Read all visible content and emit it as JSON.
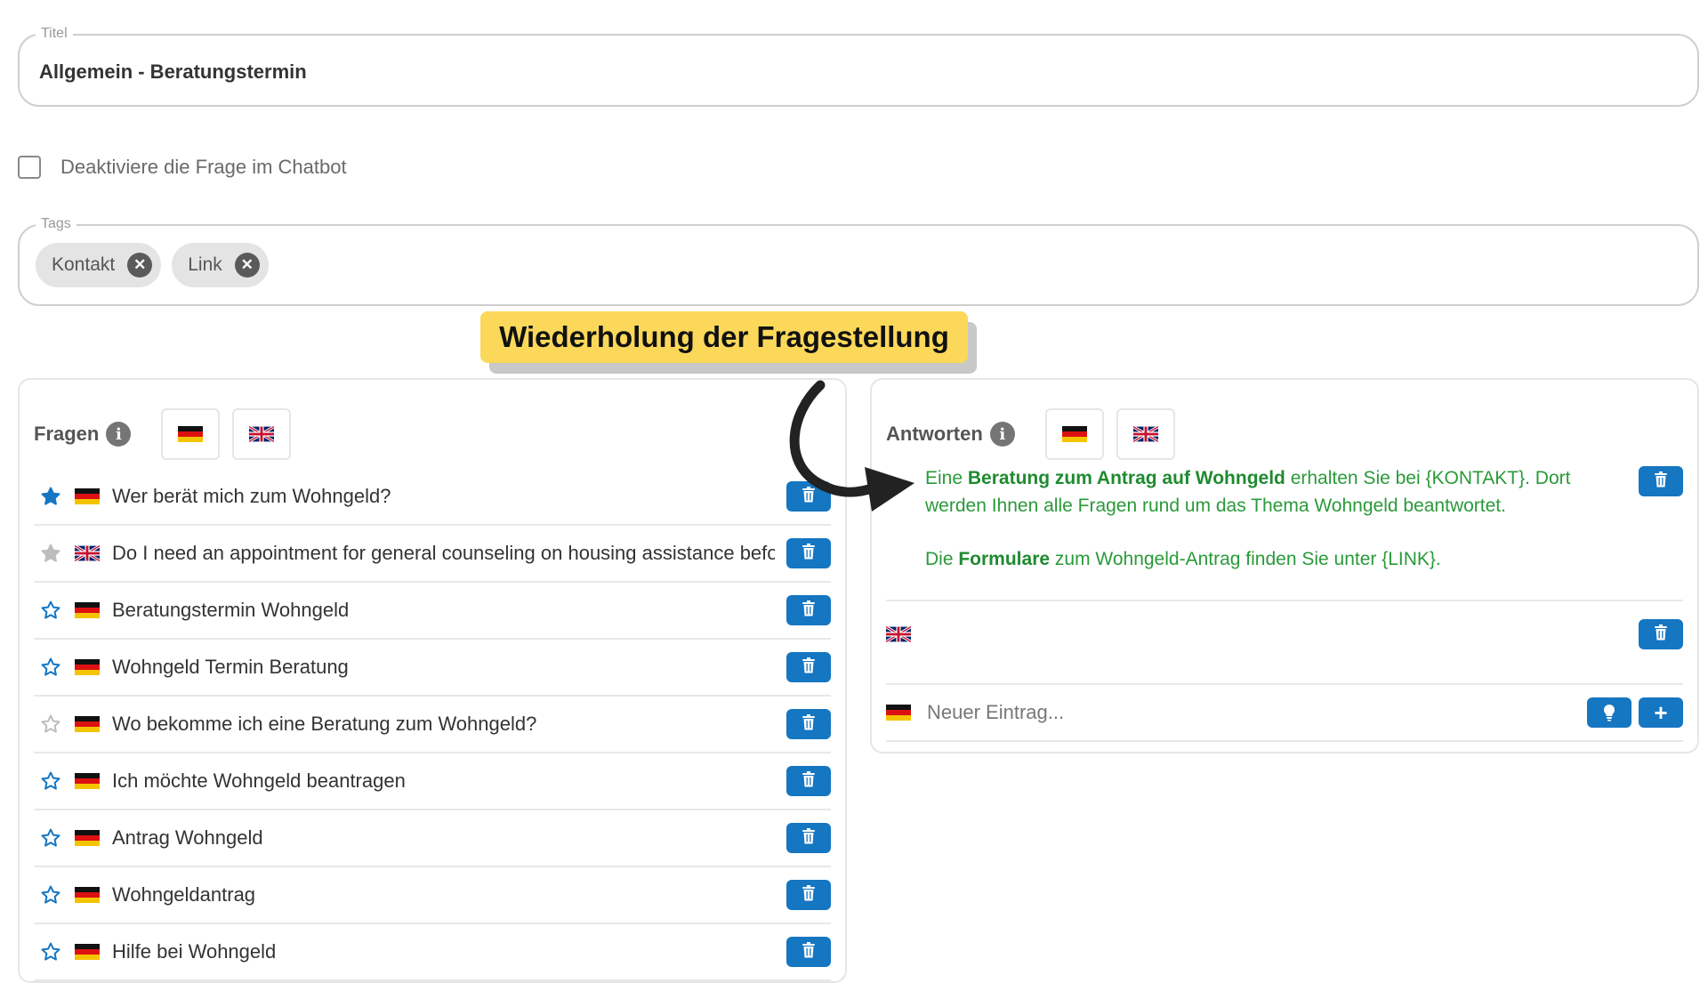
{
  "title_field": {
    "label": "Titel",
    "value": "Allgemein - Beratungstermin"
  },
  "deactivate": {
    "label": "Deaktiviere die Frage im Chatbot",
    "checked": false
  },
  "tags_field": {
    "label": "Tags",
    "tags": [
      {
        "label": "Kontakt"
      },
      {
        "label": "Link"
      }
    ]
  },
  "callout": {
    "text": "Wiederholung der Fragestellung",
    "color": "#fbd85a"
  },
  "questions": {
    "title": "Fragen",
    "items": [
      {
        "lang": "de",
        "star": "filled",
        "text": "Wer berät mich zum Wohngeld?"
      },
      {
        "lang": "gb",
        "star": "filled-gray",
        "text": "Do I need an appointment for general counseling on housing assistance before applying?"
      },
      {
        "lang": "de",
        "star": "outline",
        "text": "Beratungstermin Wohngeld"
      },
      {
        "lang": "de",
        "star": "outline",
        "text": "Wohngeld Termin Beratung"
      },
      {
        "lang": "de",
        "star": "outline-gray",
        "text": "Wo bekomme ich eine Beratung zum Wohngeld?"
      },
      {
        "lang": "de",
        "star": "outline",
        "text": "Ich möchte Wohngeld beantragen"
      },
      {
        "lang": "de",
        "star": "outline",
        "text": "Antrag Wohngeld"
      },
      {
        "lang": "de",
        "star": "outline",
        "text": "Wohngeldantrag"
      },
      {
        "lang": "de",
        "star": "outline",
        "text": "Hilfe bei Wohngeld"
      }
    ]
  },
  "answers": {
    "title": "Antworten",
    "answer_de": {
      "p1_a": "Eine ",
      "p1_b": "Beratung zum Antrag auf Wohngeld",
      "p1_c": " erhalten Sie bei {KONTAKT}. Dort werden Ihnen alle Fragen rund um das Thema Wohngeld beantwortet.",
      "p2_a": "Die ",
      "p2_b": "Formulare",
      "p2_c": " zum Wohngeld-Antrag finden Sie unter {LINK}."
    },
    "new_entry_placeholder": "Neuer Eintrag..."
  },
  "colors": {
    "accent_blue": "#1576c2",
    "answer_green": "#2a9a3a"
  }
}
